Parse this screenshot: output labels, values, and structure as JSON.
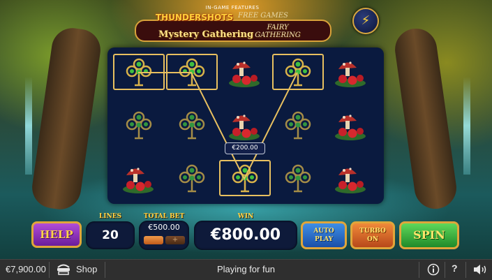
{
  "features": {
    "header": "IN-GAME FEATURES",
    "thundershots": "THUNDERSHOTS",
    "free_games": "FREE GAMES",
    "mystery": "Mystery Gathering",
    "fairy_line1": "FAIRY",
    "fairy_line2": "GATHERING",
    "bolt_button_icon": "lightning-bolt-icon"
  },
  "reels": {
    "symbols": [
      [
        "clover",
        "clover",
        "mushroom",
        "clover",
        "mushroom"
      ],
      [
        "clover",
        "clover",
        "mushroom",
        "clover",
        "mushroom"
      ],
      [
        "mushroom",
        "clover",
        "clover",
        "clover",
        "mushroom"
      ]
    ],
    "winning_positions": [
      [
        0,
        0
      ],
      [
        0,
        1
      ],
      [
        2,
        2
      ],
      [
        0,
        3
      ]
    ],
    "line_win": "€200.00"
  },
  "controls": {
    "help_label": "HELP",
    "lines_label": "LINES",
    "lines_value": "20",
    "total_bet_label": "TOTAL BET",
    "total_bet_value": "€500.00",
    "bet_plus_label": "+",
    "win_label": "WIN",
    "win_value": "€800.00",
    "auto_play_line1": "AUTO",
    "auto_play_line2": "PLAY",
    "turbo_line1": "TURBO",
    "turbo_line2": "ON",
    "spin_label": "SPIN"
  },
  "bottom_bar": {
    "balance": "€7,900.00",
    "shop_label": "Shop",
    "status": "Playing for fun",
    "help_icon_label": "?",
    "icons": [
      "shop-cart-icon",
      "info-icon",
      "help-icon",
      "volume-icon"
    ]
  },
  "colors": {
    "reel_bg": "#0a1a3f",
    "gold": "#e0a63a",
    "help": "#8a2ec0",
    "auto": "#2a6fd0",
    "turbo": "#e06a2a",
    "spin": "#3cb84a"
  }
}
